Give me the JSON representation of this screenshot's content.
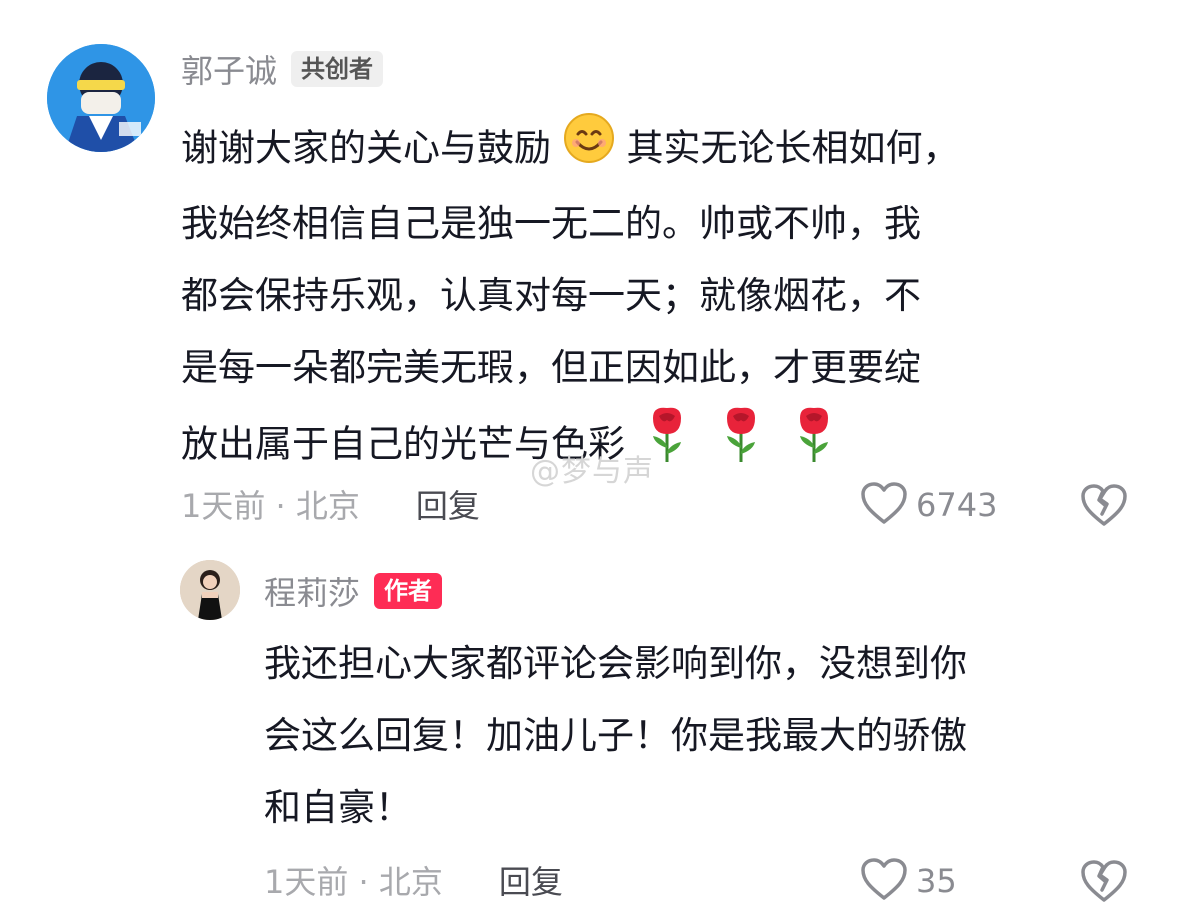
{
  "comment1": {
    "username": "郭子诚",
    "badge": "共创者",
    "lines": [
      "谢谢大家的关心与鼓励",
      "其实无论长相如何，",
      "我始终相信自己是独一无二的。帅或不帅，我",
      "都会保持乐观，认真对每一天；就像烟花，不",
      "是每一朵都完美无瑕，但正因如此，才更要绽",
      "放出属于自己的光芒与色彩"
    ],
    "emoji_inline": "smiling-face-icon",
    "emoji_trailing": [
      "rose-icon",
      "rose-icon",
      "rose-icon"
    ],
    "time_location": "1天前 · 北京",
    "reply_label": "回复",
    "likes": "6743",
    "colors": {
      "badge_bg": "#efefef",
      "username": "#8a8b91"
    }
  },
  "comment2": {
    "username": "程莉莎",
    "badge": "作者",
    "lines": [
      "我还担心大家都评论会影响到你，没想到你",
      "会这么回复！加油儿子！你是我最大的骄傲",
      "和自豪！"
    ],
    "time_location": "1天前 · 北京",
    "reply_label": "回复",
    "likes": "35",
    "colors": {
      "badge_bg": "#fe2c55"
    }
  },
  "watermark": "@梦与声"
}
